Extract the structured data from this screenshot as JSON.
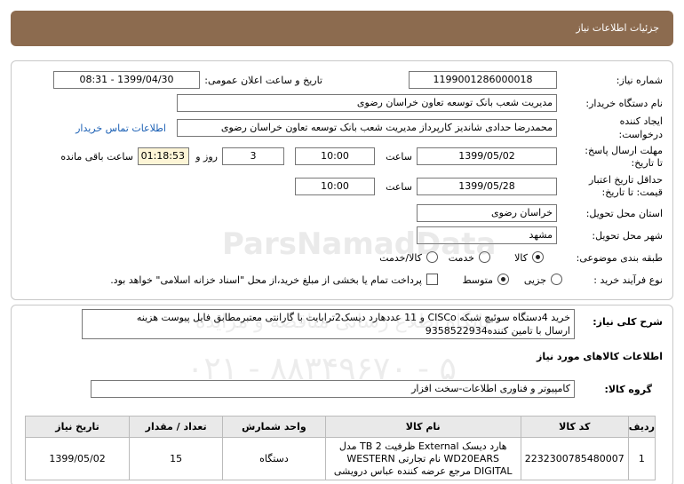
{
  "header": {
    "title": "جزئیات اطلاعات نیاز"
  },
  "fields": {
    "need_number_label": "شماره نیاز:",
    "need_number": "1199001286000018",
    "announce_label": "تاریخ و ساعت اعلان عمومی:",
    "announce_value": "1399/04/30 - 08:31",
    "buyer_label": "نام دستگاه خریدار:",
    "buyer_value": "مدیریت شعب بانک توسعه تعاون خراسان رضوی",
    "creator_label_1": "ایجاد کننده",
    "creator_label_2": "درخواست:",
    "creator_value": "محمدرضا حدادی شاندیز کارپرداز مدیریت شعب بانک توسعه تعاون خراسان رضوی",
    "contact_link": "اطلاعات تماس خریدار",
    "reply_label_1": "مهلت ارسال پاسخ:",
    "reply_label_2": "تا تاریخ:",
    "reply_date": "1399/05/02",
    "time_label": "ساعت",
    "reply_time": "10:00",
    "days_value": "3",
    "days_label": "روز و",
    "remaining_time": "01:18:53",
    "remaining_label": "ساعت باقی مانده",
    "validity_label_1": "حداقل تاریخ اعتبار",
    "validity_label_2": "قیمت: تا تاریخ:",
    "validity_date": "1399/05/28",
    "validity_time": "10:00",
    "province_label": "استان محل تحویل:",
    "province_value": "خراسان رضوی",
    "city_label": "شهر محل تحویل:",
    "city_value": "مشهد",
    "category_label": "طبقه بندی موضوعی:",
    "category_options": [
      "کالا",
      "خدمت",
      "کالا/خدمت"
    ],
    "purchase_label": "نوع فرآیند خرید :",
    "purchase_options": [
      "جزیی",
      "متوسط"
    ],
    "purchase_note": "پرداخت تمام یا بخشی از مبلغ خرید،از محل \"اسناد خزانه اسلامی\" خواهد بود."
  },
  "details": {
    "desc_label": "شرح کلی نیاز:",
    "desc_line1": "خرید 4دستگاه سوئیچ شبکه CISCo و 11 عددهارد دیسک2ترابایت با گارانتی معتبرمطابق فایل پیوست هزینه",
    "desc_line2": "ارسال با تامین کننده9358522934",
    "goods_info_title": "اطلاعات کالاهای مورد نیاز",
    "group_label": "گروه کالا:",
    "group_value": "کامپیوتر و فناوری اطلاعات-سخت افزار"
  },
  "table": {
    "headers": [
      "ردیف",
      "کد کالا",
      "نام کالا",
      "واحد شمارش",
      "تعداد / مقدار",
      "تاریخ نیاز"
    ],
    "rows": [
      {
        "index": "1",
        "code": "2232300785480007",
        "name": "هارد دیسک External ظرفیت 2 TB مدل WD20EARS نام تجارتی WESTERN DIGITAL مرجع عرضه کننده عباس درویشی",
        "unit": "دستگاه",
        "qty": "15",
        "date": "1399/05/02"
      }
    ]
  },
  "watermark": {
    "brand": "ParsNamadData",
    "tagline": "پایگاه اطلاع رسانی مناقصه و مزایده",
    "phone": "۰۲۱ - ۸۸۳۴۹۶۷۰ - ۵"
  }
}
